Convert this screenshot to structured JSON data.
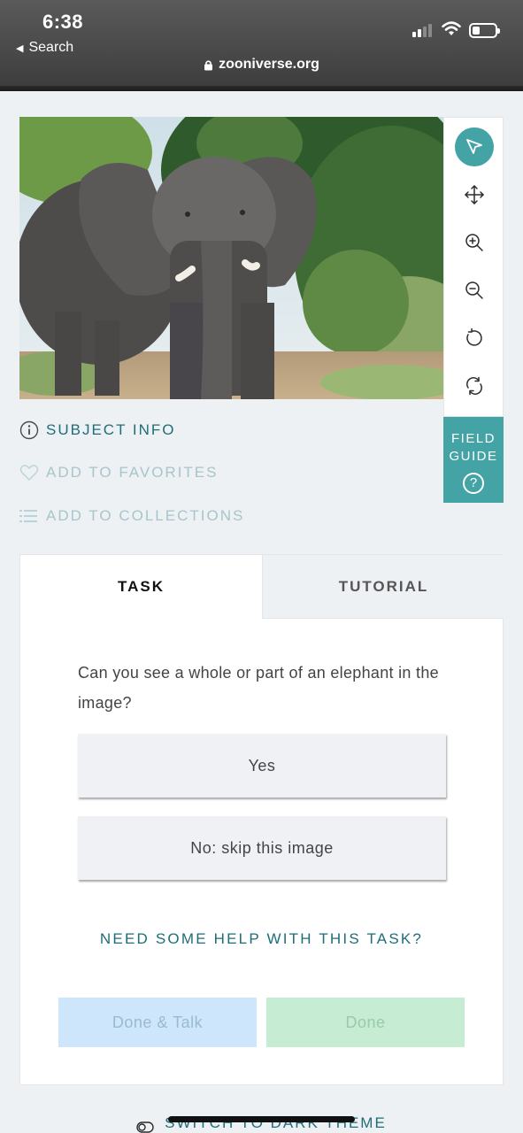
{
  "status_bar": {
    "time": "6:38",
    "back_label": "Search",
    "url": "zooniverse.org"
  },
  "subject": {
    "image_alt": "elephant",
    "tools": [
      "pointer-icon",
      "move-icon",
      "zoom-in-icon",
      "zoom-out-icon",
      "rotate-icon",
      "reset-icon"
    ],
    "field_guide_line1": "FIELD",
    "field_guide_line2": "GUIDE",
    "field_guide_help": "?"
  },
  "meta_links": {
    "subject_info": "SUBJECT INFO",
    "add_favorites": "ADD TO FAVORITES",
    "add_collections": "ADD TO COLLECTIONS"
  },
  "task_panel": {
    "tabs": [
      {
        "label": "TASK",
        "active": true
      },
      {
        "label": "TUTORIAL",
        "active": false
      }
    ],
    "question": "Can you see a whole or part of an elephant in the image?",
    "answers": [
      "Yes",
      "No: skip this image"
    ],
    "help_link": "NEED SOME HELP WITH THIS TASK?",
    "done_talk_label": "Done & Talk",
    "done_label": "Done"
  },
  "footer": {
    "theme_link": "SWITCH TO DARK THEME"
  },
  "colors": {
    "accent": "#43a3a5",
    "link": "#1f6d78",
    "done_talk_bg": "#cde6fb",
    "done_bg": "#c6ecd3",
    "page_bg": "#eef1f4"
  }
}
